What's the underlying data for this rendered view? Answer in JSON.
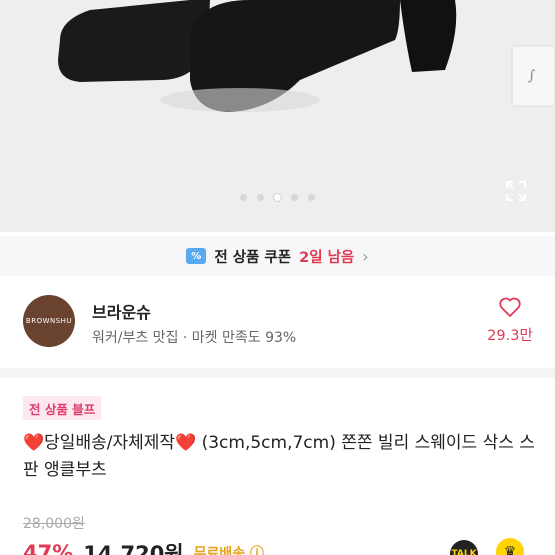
{
  "carousel": {
    "count": 5,
    "active": 3
  },
  "coupon": {
    "icon": "coupon-icon",
    "text": "전 상품 쿠폰",
    "days": "2일 남음"
  },
  "seller": {
    "name": "브라운슈",
    "avatar_text": "BROWNSHU",
    "info": "워커/부츠 맛집 · 마켓 만족도 93%",
    "likes": "29.3만"
  },
  "product": {
    "badge": "전 상품 블프",
    "title_part1": "당일배송/자체제작",
    "title_part2": " (3cm,5cm,7cm) 쫀쫀 빌리 스웨이드 삭스 스판 앵클부츠",
    "original_price": "28,000원",
    "discount": "47%",
    "price": "14,720원",
    "shipping": "무료배송 ⓘ"
  },
  "floating": {
    "talk_label": "TALK"
  },
  "colors": {
    "accent": "#e03a55",
    "ship": "#e8a118"
  }
}
